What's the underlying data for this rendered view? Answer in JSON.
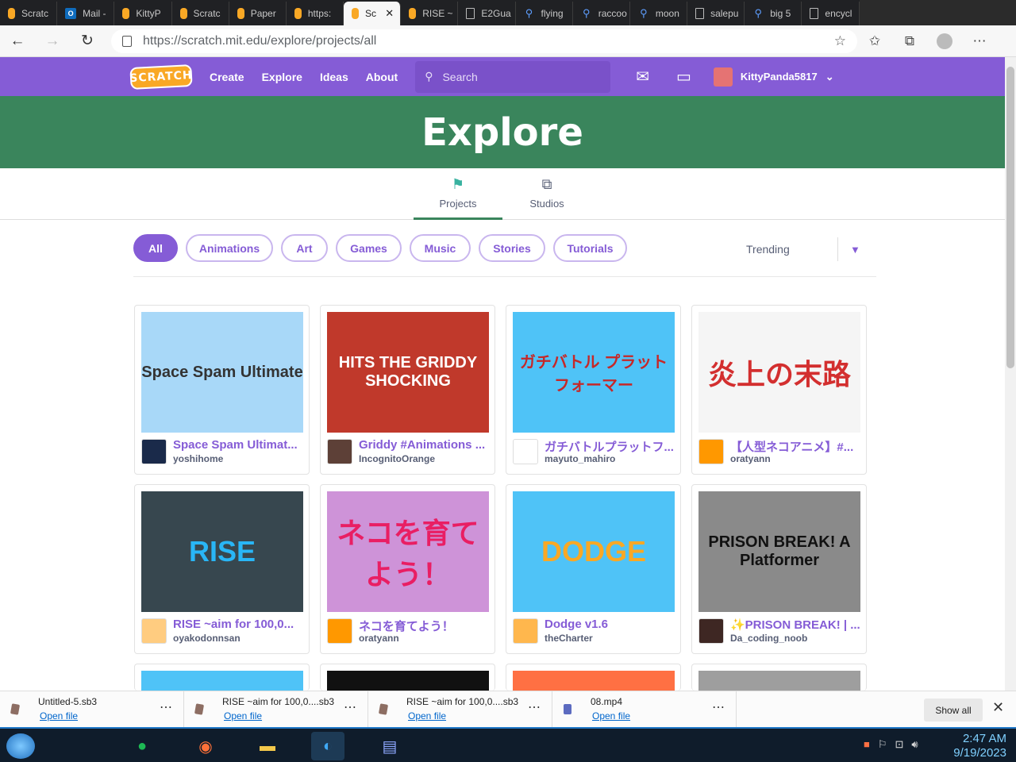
{
  "browser": {
    "tabs": [
      {
        "label": "Scratc",
        "icon": "scratch"
      },
      {
        "label": "Mail -",
        "icon": "outlook"
      },
      {
        "label": "KittyP",
        "icon": "scratch"
      },
      {
        "label": "Scratc",
        "icon": "scratch"
      },
      {
        "label": "Paper",
        "icon": "scratch"
      },
      {
        "label": "https:",
        "icon": "scratch"
      },
      {
        "label": "Sc",
        "icon": "scratch",
        "active": true
      },
      {
        "label": "RISE ~",
        "icon": "scratch"
      },
      {
        "label": "E2Gua",
        "icon": "doc"
      },
      {
        "label": "flying",
        "icon": "search"
      },
      {
        "label": "raccoo",
        "icon": "search"
      },
      {
        "label": "moon",
        "icon": "search"
      },
      {
        "label": "salepu",
        "icon": "doc"
      },
      {
        "label": "big 5",
        "icon": "search"
      },
      {
        "label": "encycl",
        "icon": "doc"
      }
    ],
    "url": "https://scratch.mit.edu/explore/projects/all"
  },
  "nav": {
    "logo": "SCRATCH",
    "links": [
      "Create",
      "Explore",
      "Ideas",
      "About"
    ],
    "search_placeholder": "Search",
    "username": "KittyPanda5817"
  },
  "hero": {
    "title": "Explore"
  },
  "subtabs": [
    {
      "label": "Projects",
      "active": true
    },
    {
      "label": "Studios"
    }
  ],
  "filters": {
    "chips": [
      "All",
      "Animations",
      "Art",
      "Games",
      "Music",
      "Stories",
      "Tutorials"
    ],
    "active": "All",
    "sort": "Trending"
  },
  "projects": [
    {
      "title": "Space Spam Ultimat...",
      "author": "yoshihome",
      "thumb_text": "Space Spam Ultimate",
      "bg": "#a8d8f8",
      "avatar": "#1a2a4a"
    },
    {
      "title": "Griddy #Animations ...",
      "author": "IncognitoOrange",
      "thumb_text": "HITS THE GRIDDY SHOCKING",
      "bg": "#c0392b",
      "avatar": "#5d4037"
    },
    {
      "title": "ガチバトルプラットフ...",
      "author": "mayuto_mahiro",
      "thumb_text": "ガチバトル プラットフォーマー",
      "bg": "#4fc3f7",
      "avatar": "#ffffff"
    },
    {
      "title": "【人型ネコアニメ】#...",
      "author": "oratyann",
      "thumb_text": "炎上の末路",
      "bg": "#f5f5f5",
      "avatar": "#ff9800"
    },
    {
      "title": "RISE ~aim for 100,0...",
      "author": "oyakodonnsan",
      "thumb_text": "RISE",
      "bg": "#37474f",
      "avatar": "#ffcc80"
    },
    {
      "title": "ネコを育てよう！",
      "author": "oratyann",
      "thumb_text": "ネコを育てよう！",
      "bg": "#ce93d8",
      "avatar": "#ff9800"
    },
    {
      "title": "Dodge v1.6",
      "author": "theCharter",
      "thumb_text": "DODGE",
      "bg": "#4fc3f7",
      "avatar": "#ffb74d"
    },
    {
      "title": "✨PRISON BREAK! | ...",
      "author": "Da_coding_noob",
      "thumb_text": "PRISON BREAK! A Platformer",
      "bg": "#8a8a8a",
      "avatar": "#3e2723"
    }
  ],
  "downloads": [
    {
      "name": "Untitled-5.sb3",
      "action": "Open file"
    },
    {
      "name": "RISE ~aim for 100,0....sb3",
      "action": "Open file"
    },
    {
      "name": "RISE ~aim for 100,0....sb3",
      "action": "Open file"
    },
    {
      "name": "08.mp4",
      "action": "Open file"
    }
  ],
  "show_all": "Show all",
  "clock": {
    "time": "2:47 AM",
    "date": "9/19/2023"
  }
}
